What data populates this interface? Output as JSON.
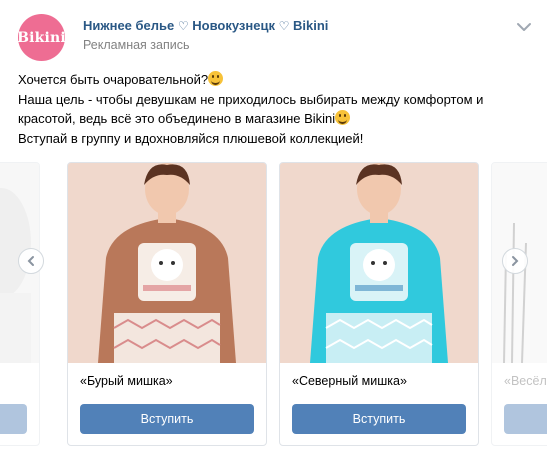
{
  "post": {
    "group_name_1": "Нижнее белье",
    "group_heart_1": "♡",
    "group_name_2": "Новокузнецк",
    "group_heart_2": "♡",
    "group_name_3": "Bikini",
    "ad_label": "Рекламная запись",
    "avatar_text": "Bikini",
    "text_line1": "Хочется быть очаровательной?",
    "text_line2": "Наша цель - чтобы девушкам не приходилось выбирать между комфортом и",
    "text_line3": "красотой, ведь всё это объединено в магазине Bikini",
    "text_line4": "Вступай в группу и вдохновляйся плюшевой коллекцией!"
  },
  "carousel": {
    "cards": [
      {
        "caption": "",
        "button": ""
      },
      {
        "caption": "«Бурый мишка»",
        "button": "Вступить",
        "shirt_color": "#b9785a"
      },
      {
        "caption": "«Северный мишка»",
        "button": "Вступить",
        "shirt_color": "#30c9dd"
      },
      {
        "caption": "«Весёл",
        "button": ""
      }
    ]
  },
  "colors": {
    "link": "#2a5885",
    "button": "#5181b8",
    "avatar": "#ee6d93",
    "muted": "#828282"
  },
  "icons": [
    "chevron-down-icon",
    "chevron-left-icon",
    "chevron-right-icon",
    "emoji-grin",
    "emoji-wink"
  ]
}
